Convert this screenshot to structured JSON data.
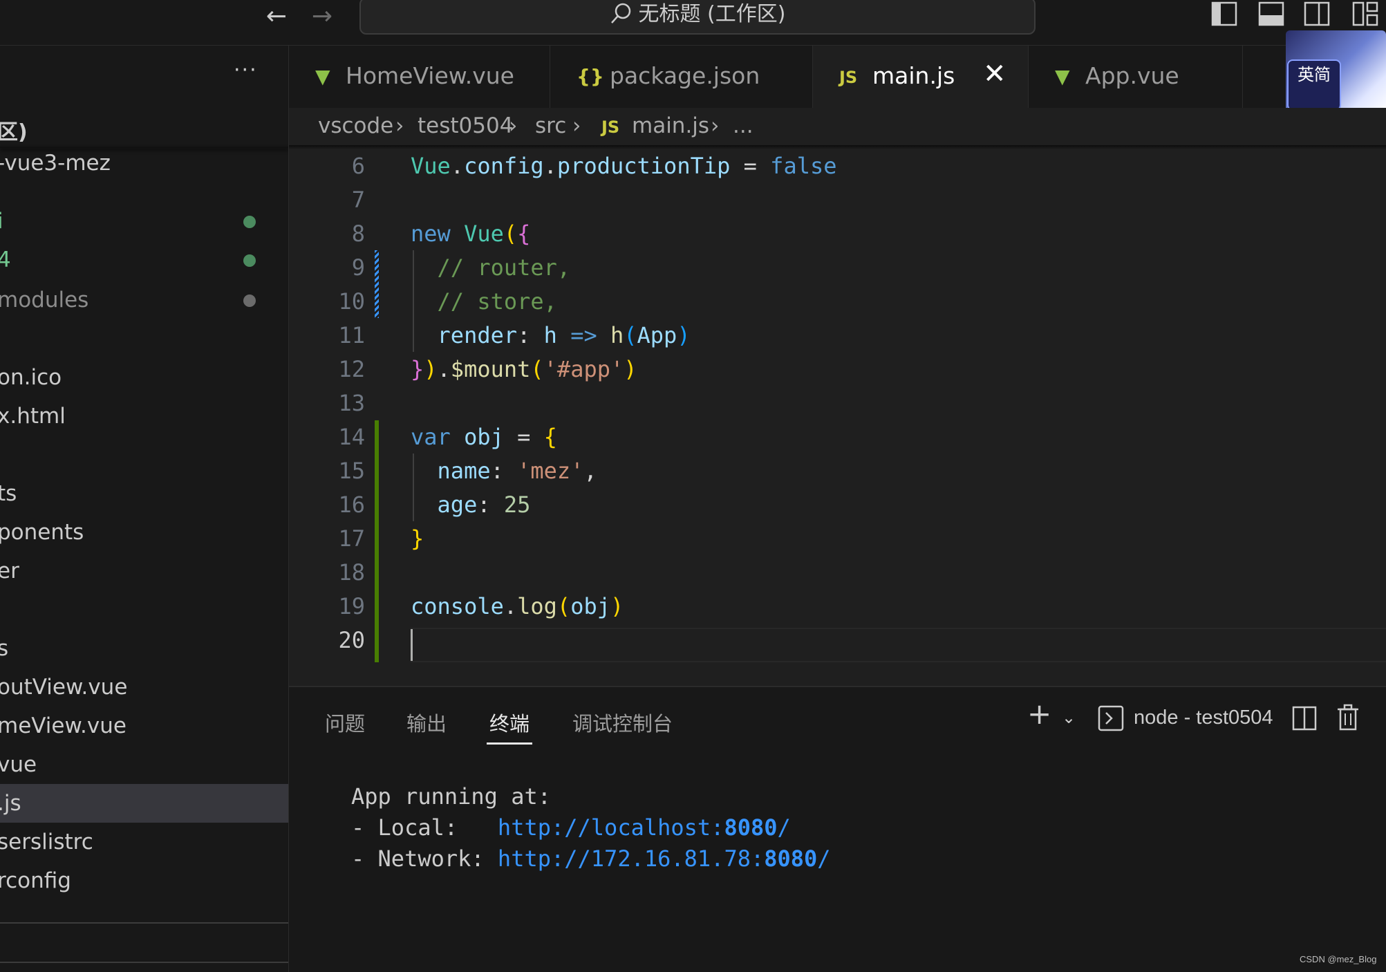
{
  "titlebar": {
    "search_text": "无标题 (工作区)"
  },
  "sidebar": {
    "section_title": "区)",
    "items": [
      {
        "label": "-vue3-mez",
        "color": "#cccccc",
        "dot": null
      },
      {
        "label": "i",
        "color": "#73c991",
        "dot": "#4b8b5f"
      },
      {
        "label": "4",
        "color": "#73c991",
        "dot": "#4b8b5f"
      },
      {
        "label": "modules",
        "color": "#8c8c8c",
        "dot": "#6b6b6b"
      },
      {
        "label": "on.ico",
        "color": "#cccccc",
        "dot": null
      },
      {
        "label": "x.html",
        "color": "#cccccc",
        "dot": null
      },
      {
        "label": "ts",
        "color": "#cccccc",
        "dot": null
      },
      {
        "label": "ponents",
        "color": "#cccccc",
        "dot": null
      },
      {
        "label": "er",
        "color": "#cccccc",
        "dot": null
      },
      {
        "label": "",
        "color": "#cccccc",
        "dot": null
      },
      {
        "label": "s",
        "color": "#cccccc",
        "dot": null
      },
      {
        "label": "outView.vue",
        "color": "#cccccc",
        "dot": null
      },
      {
        "label": "meView.vue",
        "color": "#cccccc",
        "dot": null
      },
      {
        "label": "vue",
        "color": "#cccccc",
        "dot": null
      },
      {
        "label": ".js",
        "color": "#cccccc",
        "dot": null,
        "selected": true
      },
      {
        "label": "serslistrc",
        "color": "#cccccc",
        "dot": null
      },
      {
        "label": "rconfig",
        "color": "#cccccc",
        "dot": null
      }
    ]
  },
  "tabs": [
    {
      "label": "HomeView.vue",
      "icon": "vue-icon",
      "active": false
    },
    {
      "label": "package.json",
      "icon": "json-icon",
      "active": false
    },
    {
      "label": "main.js",
      "icon": "js-icon",
      "active": true
    },
    {
      "label": "App.vue",
      "icon": "vue-icon",
      "active": false
    }
  ],
  "ime_badge": "英简",
  "breadcrumb": {
    "parts": [
      "vscode",
      "test0504",
      "src",
      "main.js",
      "..."
    ],
    "js_badge": "JS"
  },
  "editor": {
    "line_numbers": [
      "6",
      "7",
      "8",
      "9",
      "10",
      "11",
      "12",
      "13",
      "14",
      "15",
      "16",
      "17",
      "18",
      "19",
      "20"
    ],
    "current_line": "20"
  },
  "panel": {
    "tabs": [
      "问题",
      "输出",
      "终端",
      "调试控制台"
    ],
    "active_tab": "终端",
    "terminal_name": "node - test0504",
    "terminal_lines": {
      "line1": "App running at:",
      "local_prefix": "- Local:   ",
      "local_url": "http://localhost:",
      "local_port": "8080",
      "local_slash": "/",
      "network_prefix": "- Network: ",
      "network_url": "http://172.16.81.78:",
      "network_port": "8080",
      "network_slash": "/"
    }
  },
  "watermark": "CSDN @mez_Blog",
  "colors": {
    "accent_green": "#73c991",
    "vue_green": "#8dc149",
    "js_yellow": "#cbcb41",
    "modified_bar": "#3794ff",
    "added_bar": "#487e02"
  }
}
